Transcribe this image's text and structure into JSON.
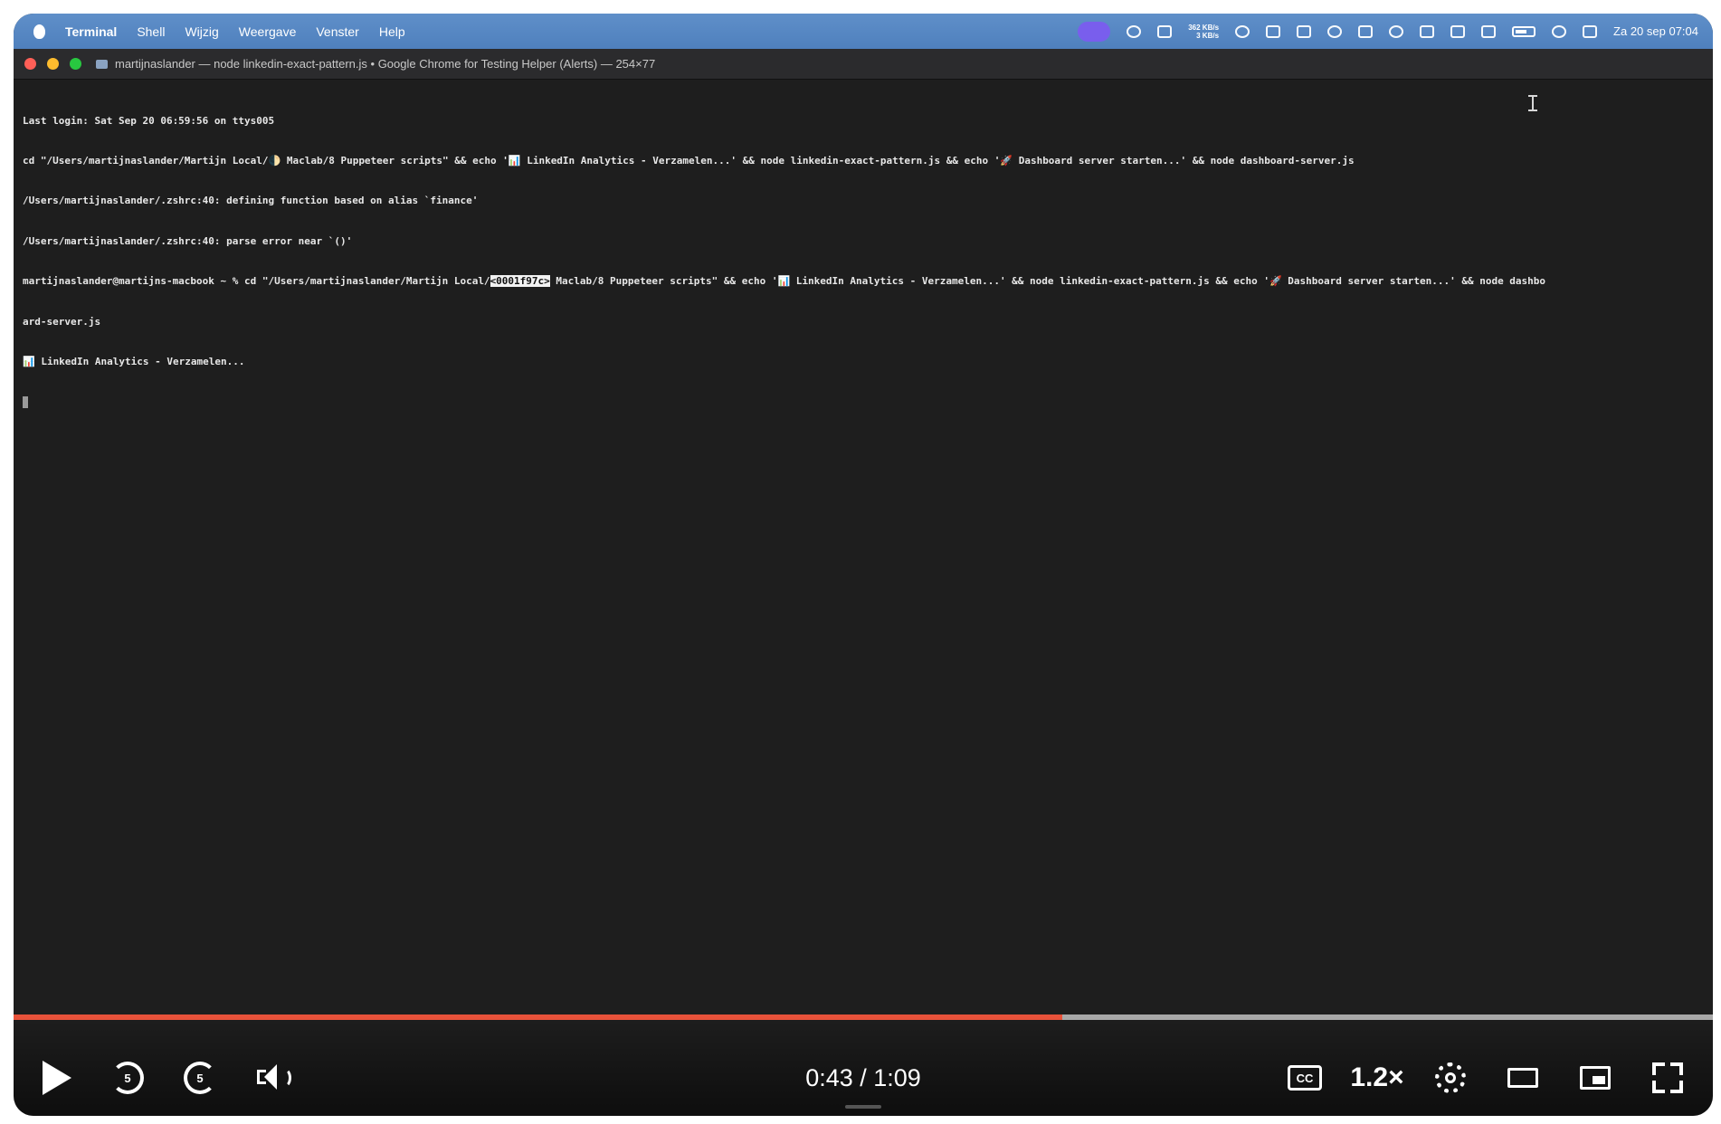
{
  "menubar": {
    "app": "Terminal",
    "items": [
      "Shell",
      "Wijzig",
      "Weergave",
      "Venster",
      "Help"
    ],
    "net_up": "362 KB/s",
    "net_down": "3 KB/s",
    "datetime": "Za 20 sep  07:04"
  },
  "window": {
    "title": "martijnaslander — node linkedin-exact-pattern.js • Google Chrome for Testing Helper (Alerts) — 254×77"
  },
  "terminal": {
    "line1": "Last login: Sat Sep 20 06:59:56 on ttys005",
    "line2": "cd \"/Users/martijnaslander/Martijn Local/🌓 Maclab/8 Puppeteer scripts\" && echo '📊 LinkedIn Analytics - Verzamelen...' && node linkedin-exact-pattern.js && echo '🚀 Dashboard server starten...' && node dashboard-server.js",
    "line3": "/Users/martijnaslander/.zshrc:40: defining function based on alias `finance'",
    "line4": "/Users/martijnaslander/.zshrc:40: parse error near `()'",
    "line5_a": "martijnaslander@martijns-macbook ~ % cd \"/Users/martijnaslander/Martijn Local/",
    "line5_tag": "<0001f97c>",
    "line5_b": " Maclab/8 Puppeteer scripts\" && echo '📊 LinkedIn Analytics - Verzamelen...' && node linkedin-exact-pattern.js && echo '🚀 Dashboard server starten...' && node dashbo",
    "line6": "ard-server.js",
    "line7": "📊 LinkedIn Analytics - Verzamelen..."
  },
  "player": {
    "time": "0:43 / 1:09",
    "progress": 0.617,
    "speed": "1.2×",
    "skip_back": "5",
    "skip_forward": "5",
    "cc": "CC",
    "accent": "#e8523a"
  }
}
